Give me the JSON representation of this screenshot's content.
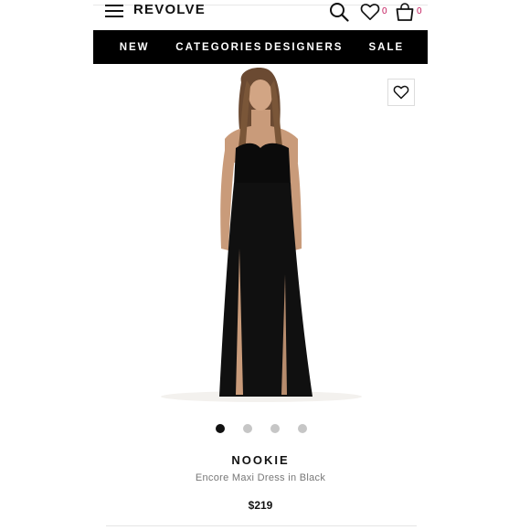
{
  "header": {
    "menu_icon": "hamburger-menu-icon",
    "logo": "REVOLVE",
    "search_icon": "search-icon",
    "wishlist_icon": "heart-icon",
    "wishlist_count": "0",
    "bag_icon": "shopping-bag-icon",
    "bag_count": "0"
  },
  "nav": {
    "items": [
      "NEW",
      "CATEGORIES",
      "DESIGNERS",
      "SALE"
    ]
  },
  "product": {
    "image_subject": "model in strapless black maxi dress with side slits",
    "wishlist_button_icon": "heart-outline-icon",
    "carousel": {
      "count": 4,
      "active_index": 0
    },
    "brand": "NOOKIE",
    "name": "Encore Maxi Dress in Black",
    "price": "$219"
  },
  "colors": {
    "nav_background": "#000000",
    "accent_count": "#c2185b",
    "dot_active": "#111111",
    "dot_inactive": "#c6c6c6"
  }
}
